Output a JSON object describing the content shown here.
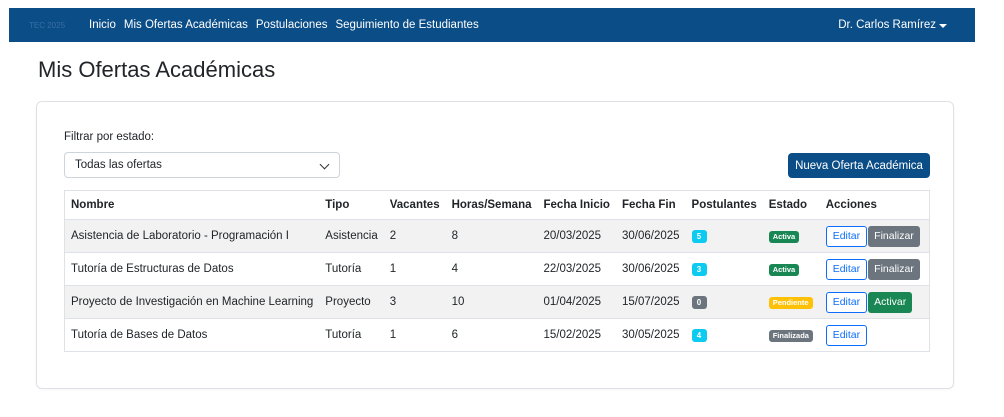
{
  "nav": {
    "brand": "TEC 2025",
    "links": [
      "Inicio",
      "Mis Ofertas Académicas",
      "Postulaciones",
      "Seguimiento de Estudiantes"
    ],
    "user": "Dr. Carlos Ramírez"
  },
  "page": {
    "title": "Mis Ofertas Académicas"
  },
  "filter": {
    "label": "Filtrar por estado:",
    "selected": "Todas las ofertas"
  },
  "actions": {
    "new_offer": "Nueva Oferta Académica"
  },
  "table": {
    "headers": [
      "Nombre",
      "Tipo",
      "Vacantes",
      "Horas/Semana",
      "Fecha Inicio",
      "Fecha Fin",
      "Postulantes",
      "Estado",
      "Acciones"
    ],
    "rows": [
      {
        "nombre": "Asistencia de Laboratorio - Programación I",
        "tipo": "Asistencia",
        "vacantes": "2",
        "horas": "8",
        "inicio": "20/03/2025",
        "fin": "30/06/2025",
        "postulantes": "5",
        "postulantes_color": "#0dcaf0",
        "estado": "Activa",
        "estado_bg": "#198754",
        "estado_fg": "#ffffff",
        "editar": "Editar",
        "accion": "Finalizar",
        "accion_bg": "#6c757d"
      },
      {
        "nombre": "Tutoría de Estructuras de Datos",
        "tipo": "Tutoría",
        "vacantes": "1",
        "horas": "4",
        "inicio": "22/03/2025",
        "fin": "30/06/2025",
        "postulantes": "3",
        "postulantes_color": "#0dcaf0",
        "estado": "Activa",
        "estado_bg": "#198754",
        "estado_fg": "#ffffff",
        "editar": "Editar",
        "accion": "Finalizar",
        "accion_bg": "#6c757d"
      },
      {
        "nombre": "Proyecto de Investigación en Machine Learning",
        "tipo": "Proyecto",
        "vacantes": "3",
        "horas": "10",
        "inicio": "01/04/2025",
        "fin": "15/07/2025",
        "postulantes": "0",
        "postulantes_color": "#6c757d",
        "estado": "Pendiente",
        "estado_bg": "#ffc107",
        "estado_fg": "#ffffff",
        "editar": "Editar",
        "accion": "Activar",
        "accion_bg": "#198754"
      },
      {
        "nombre": "Tutoría de Bases de Datos",
        "tipo": "Tutoría",
        "vacantes": "1",
        "horas": "6",
        "inicio": "15/02/2025",
        "fin": "30/05/2025",
        "postulantes": "4",
        "postulantes_color": "#0dcaf0",
        "estado": "Finalizada",
        "estado_bg": "#6c757d",
        "estado_fg": "#ffffff",
        "editar": "Editar",
        "accion": "",
        "accion_bg": ""
      }
    ]
  },
  "colors": {
    "navbar": "#0b4d87",
    "primary": "#0b4d87",
    "outline": "#0d6efd"
  }
}
